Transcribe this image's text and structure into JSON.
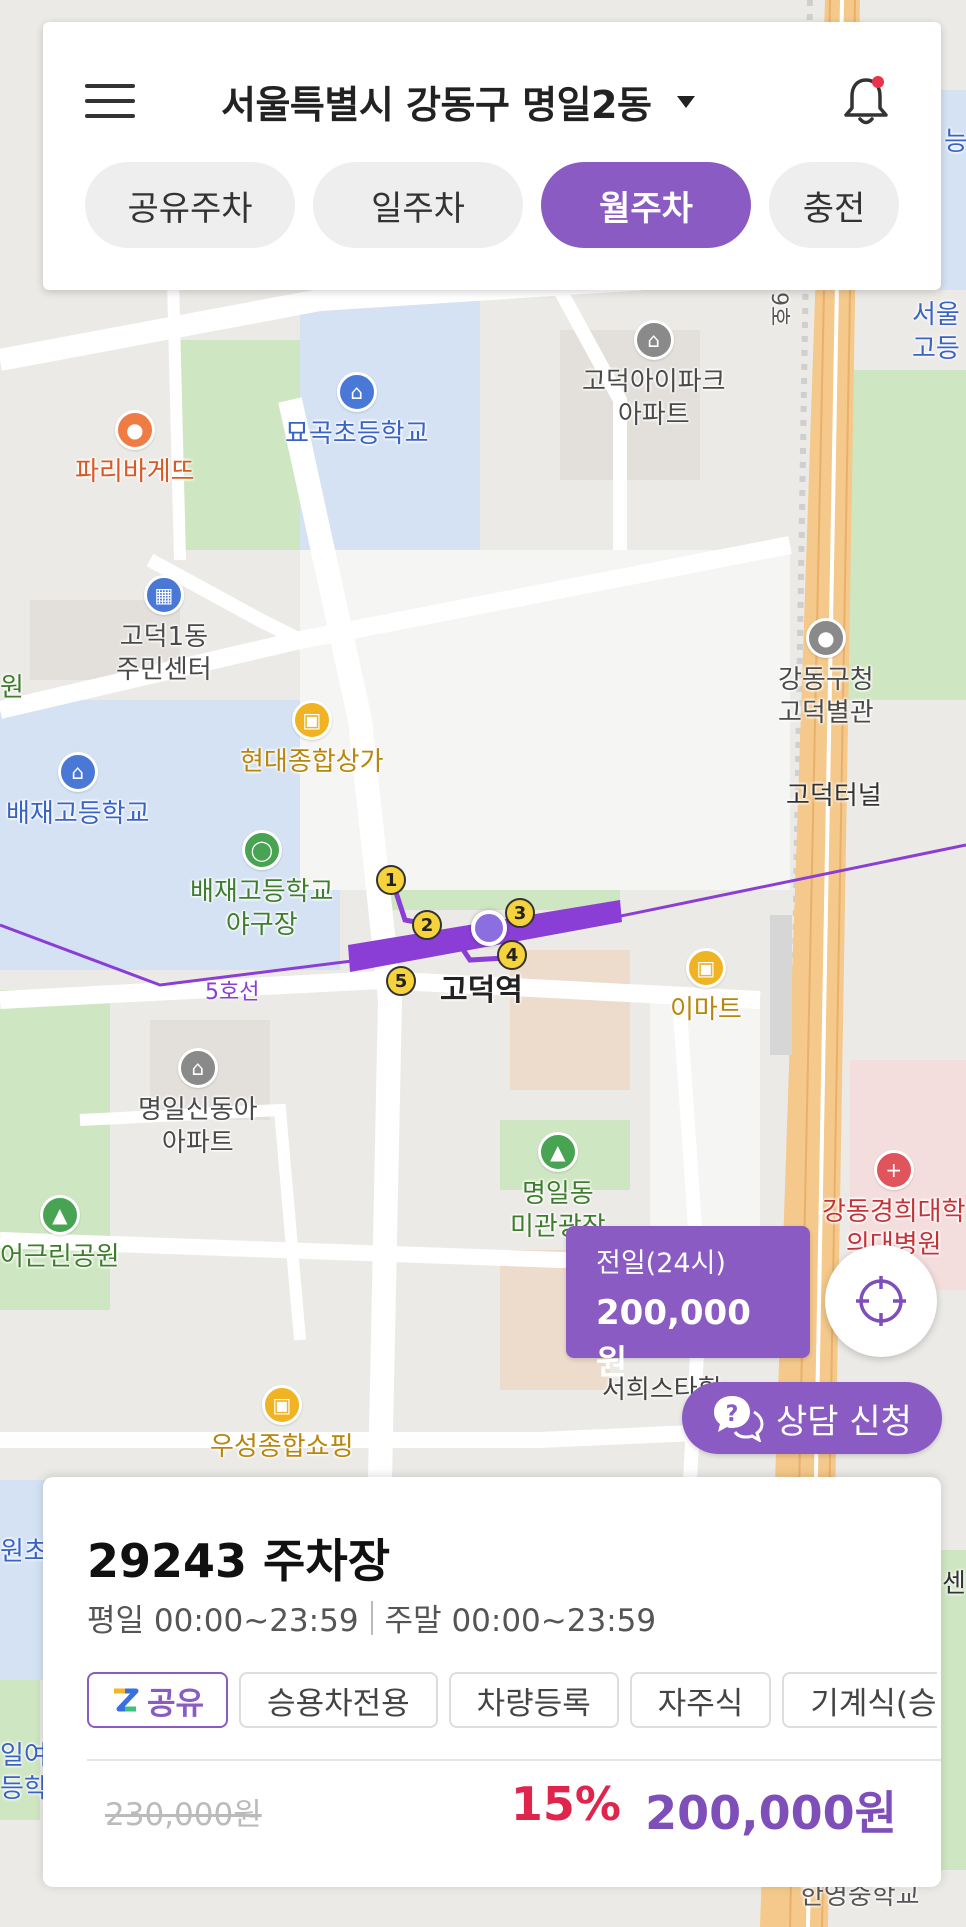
{
  "header": {
    "location": "서울특별시 강동구 명일2동",
    "tabs": [
      {
        "label": "공유주차",
        "active": false
      },
      {
        "label": "일주차",
        "active": false
      },
      {
        "label": "월주차",
        "active": true
      },
      {
        "label": "충전",
        "active": false
      }
    ]
  },
  "colors": {
    "accent": "#8a5bc2",
    "discount": "#e0254d",
    "notification_dot": "#e8334a",
    "subway_line": "#8a3ed6"
  },
  "map": {
    "pois": [
      {
        "label": "묘곡초등학교",
        "icon": "school-icon"
      },
      {
        "label": "고덕아이파크\n아파트",
        "icon": "apartment-icon"
      },
      {
        "label": "파리바게뜨",
        "icon": "bakery-icon"
      },
      {
        "label": "고덕1동\n주민센터",
        "icon": "government-icon"
      },
      {
        "label": "현대종합상가",
        "icon": "shopping-icon"
      },
      {
        "label": "배재고등학교",
        "icon": "school-icon"
      },
      {
        "label": "배재고등학교\n야구장",
        "icon": "stadium-icon"
      },
      {
        "label": "강동구청\n고덕별관",
        "icon": "office-icon"
      },
      {
        "label": "이마트",
        "icon": "shopping-icon"
      },
      {
        "label": "명일신동아\n아파트",
        "icon": "apartment-icon"
      },
      {
        "label": "명일동\n미관광장",
        "icon": "park-icon"
      },
      {
        "label": "우성종합쇼핑",
        "icon": "shopping-icon"
      },
      {
        "label": "어근린공원",
        "icon": "park-icon"
      },
      {
        "label": "강동경희대학\n의대병원",
        "icon": "hospital-icon"
      }
    ],
    "texts": {
      "tunnel": "고덕터널",
      "station": "고덕역",
      "line": "5호선",
      "road_no": "9호",
      "edge_top_right": "서울\n고등",
      "edge_left": "원",
      "edge_bottom_left": "원초",
      "edge_bottom_left2": "일여\n등학",
      "edge_top_right2": "능",
      "edge_right": "센",
      "partial_poi": "서희스타힐",
      "bottom_edge": "한영중학교"
    },
    "exits": [
      "1",
      "2",
      "3",
      "4",
      "5"
    ]
  },
  "price_bubble": {
    "type": "전일(24시)",
    "price": "200,000원"
  },
  "consult_button": {
    "label": "상담 신청"
  },
  "parking_lot": {
    "title": "29243 주차장",
    "weekday": "평일 00:00~23:59",
    "weekend": "주말 00:00~23:59",
    "tags": [
      "공유",
      "승용차전용",
      "차량등록",
      "자주식",
      "기계식(승"
    ],
    "original_price": "230,000원",
    "discount": "15%",
    "final_price": "200,000원"
  }
}
